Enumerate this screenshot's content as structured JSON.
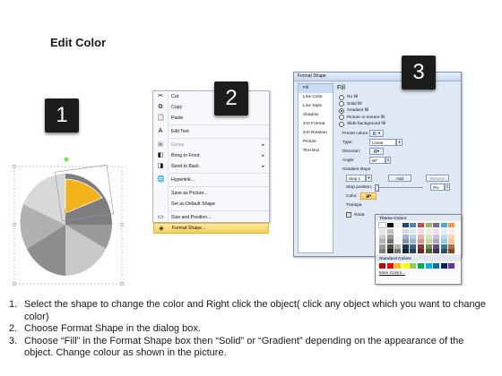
{
  "title": "Edit Color",
  "badges": {
    "step1": "1",
    "step2": "2",
    "step3": "3"
  },
  "context_menu": {
    "items": [
      {
        "label": "Cut",
        "icon": "scissors-icon",
        "glyph": "✂",
        "disabled": false,
        "submenu": false
      },
      {
        "label": "Copy",
        "icon": "copy-icon",
        "glyph": "⧉",
        "disabled": false,
        "submenu": false
      },
      {
        "label": "Paste",
        "icon": "paste-icon",
        "glyph": "📋",
        "disabled": false,
        "submenu": false
      },
      {
        "label": "Edit Text",
        "icon": "edit-text-icon",
        "glyph": "A",
        "disabled": false,
        "submenu": false
      },
      {
        "label": "Group",
        "icon": "group-icon",
        "glyph": "▣",
        "disabled": true,
        "submenu": true
      },
      {
        "label": "Bring to Front",
        "icon": "bring-front-icon",
        "glyph": "◧",
        "disabled": false,
        "submenu": true
      },
      {
        "label": "Send to Back",
        "icon": "send-back-icon",
        "glyph": "◨",
        "disabled": false,
        "submenu": true
      },
      {
        "label": "Hyperlink...",
        "icon": "hyperlink-icon",
        "glyph": "🌐",
        "disabled": false,
        "submenu": false
      },
      {
        "label": "Save as Picture...",
        "icon": "",
        "glyph": "",
        "disabled": false,
        "submenu": false
      },
      {
        "label": "Set as Default Shape",
        "icon": "",
        "glyph": "",
        "disabled": false,
        "submenu": false
      },
      {
        "label": "Size and Position...",
        "icon": "size-position-icon",
        "glyph": "▭",
        "disabled": false,
        "submenu": false
      },
      {
        "label": "Format Shape...",
        "icon": "format-shape-icon",
        "glyph": "◈",
        "disabled": false,
        "submenu": false,
        "highlighted": true
      }
    ]
  },
  "dialog": {
    "title": "Format Shape",
    "nav": [
      "Fill",
      "Line Color",
      "Line Style",
      "Shadow",
      "3-D Format",
      "3-D Rotation",
      "Picture",
      "Text Box"
    ],
    "section_title": "Fill",
    "fill_options": [
      {
        "label": "No fill",
        "selected": false
      },
      {
        "label": "Solid fill",
        "selected": false
      },
      {
        "label": "Gradient fill",
        "selected": true
      },
      {
        "label": "Picture or texture fill",
        "selected": false
      },
      {
        "label": "Slide background fill",
        "selected": false
      }
    ],
    "preset_colors_label": "Preset colors:",
    "type_label": "Type:",
    "type_value": "Linear",
    "direction_label": "Direction:",
    "angle_label": "Angle:",
    "angle_value": "90°",
    "gradient_stops_label": "Gradient stops",
    "stop_value": "Stop 1",
    "add_label": "Add",
    "remove_label": "Remove",
    "stop_position_label": "Stop position:",
    "stop_position_value": "0%",
    "color_label": "Color:",
    "transparency_label": "Transpa",
    "rotate_label": "Rotat"
  },
  "palette": {
    "theme_title": "Theme Colors",
    "theme_top": [
      "#ffffff",
      "#000000",
      "#eeece1",
      "#1f497d",
      "#4f81bd",
      "#c0504d",
      "#9bbb59",
      "#8064a2",
      "#4bacc6",
      "#f79646"
    ],
    "standard_title": "Standard Colors",
    "standard": [
      "#c00000",
      "#ff0000",
      "#ffc000",
      "#ffff00",
      "#92d050",
      "#00b050",
      "#00b0f0",
      "#0070c0",
      "#002060",
      "#7030a0"
    ],
    "more_label": "More Colors..."
  },
  "pie": {
    "highlight_color": "#f3b21a",
    "slices": 6
  },
  "instructions": [
    {
      "num": "1.",
      "text": "Select the shape to change the color and Right click the object( click any object which you want to change color)"
    },
    {
      "num": "2.",
      "text": "Choose Format Shape in the dialog box."
    },
    {
      "num": "3.",
      "text": "Choose “Fill” in the Format Shape box then “Solid” or “Gradient” depending on the appearance of the object. Change colour as shown in the picture."
    }
  ]
}
